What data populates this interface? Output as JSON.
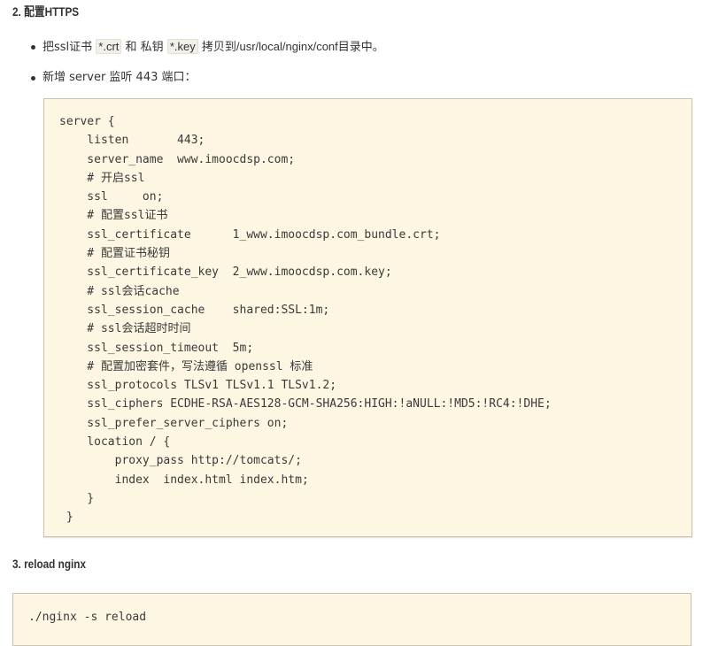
{
  "section2": {
    "heading": "2. 配置HTTPS",
    "bullets": [
      {
        "t1": "把ssl证书 ",
        "c1": "*.crt",
        "t2": " 和 私钥 ",
        "c2": "*.key",
        "t3": " 拷贝到",
        "path": "/usr/local/nginx/conf",
        "t4": "目录中。"
      },
      {
        "text": "新增 server 监听 443 端口："
      }
    ],
    "code_lines": [
      "server {",
      "    listen       443;",
      "    server_name  www.imoocdsp.com;",
      "    # 开启ssl",
      "    ssl     on;",
      "    # 配置ssl证书",
      "    ssl_certificate      1_www.imoocdsp.com_bundle.crt;",
      "    # 配置证书秘钥",
      "    ssl_certificate_key  2_www.imoocdsp.com.key;",
      "    # ssl会话cache",
      "    ssl_session_cache    shared:SSL:1m;",
      "    # ssl会话超时时间",
      "    ssl_session_timeout  5m;",
      "    # 配置加密套件，写法遵循 openssl 标准",
      "    ssl_protocols TLSv1 TLSv1.1 TLSv1.2;",
      "    ssl_ciphers ECDHE-RSA-AES128-GCM-SHA256:HIGH:!aNULL:!MD5:!RC4:!DHE;",
      "    ssl_prefer_server_ciphers on;",
      "    location / {",
      "        proxy_pass http://tomcats/;",
      "        index  index.html index.htm;",
      "    }",
      " }"
    ]
  },
  "section3": {
    "heading": "3. reload nginx",
    "code_lines": [
      "./nginx -s reload"
    ]
  }
}
